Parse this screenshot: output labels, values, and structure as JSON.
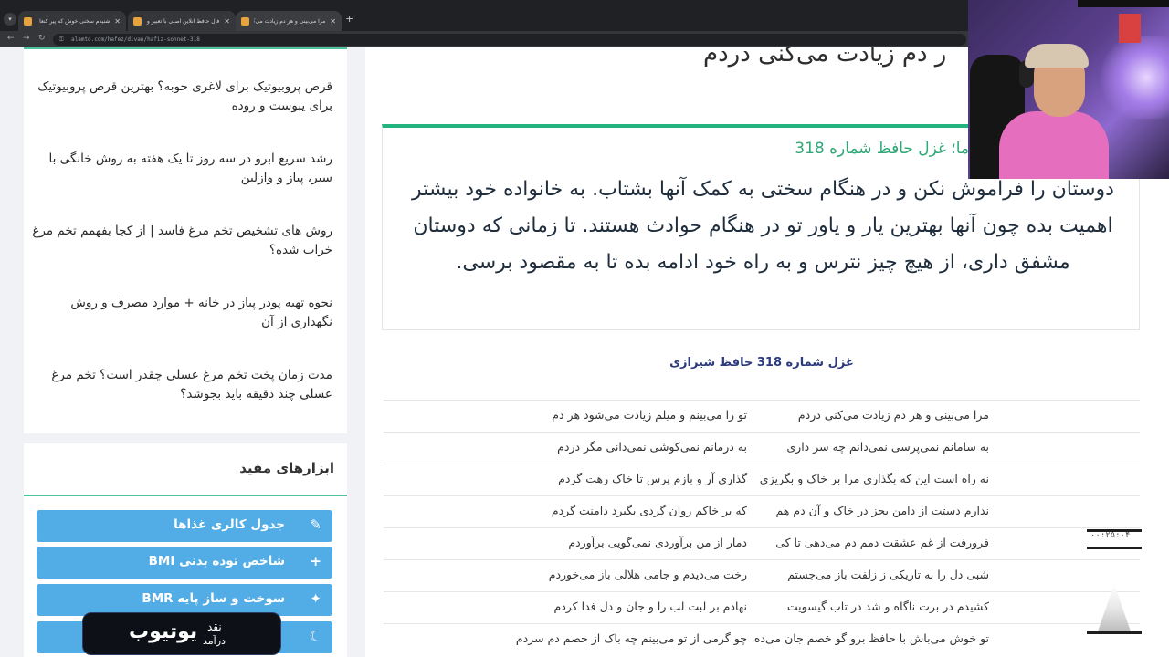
{
  "browser": {
    "menu_icon": "chevron-down-icon",
    "tabs": [
      {
        "title": "شنیدم سخنی خوش که پیر کنعا",
        "active": false
      },
      {
        "title": "فال حافظ آنلاین اصلی با تعبیر و",
        "active": false
      },
      {
        "title": "مرا می‌بینی و هر دم زیادت می‌ک",
        "active": true
      }
    ],
    "new_tab_icon": "plus-icon",
    "url": "alamto.com/hafez/divan/hafiz-sonnet-318"
  },
  "sidebar": {
    "articles": [
      "قرص پروبیوتیک برای لاغری خوبه؟ بهترین قرص پروبیوتیک برای یبوست و روده",
      "رشد سریع ابرو در سه روز تا یک هفته به روش خانگی با سیر، پیاز و وازلین",
      "روش های تشخیص تخم مرغ فاسد | از کجا بفهمم تخم مرغ خراب شده؟",
      "نحوه تهیه پودر پیاز در خانه + موارد مصرف و روش نگهداری از آن",
      "مدت زمان پخت تخم مرغ عسلی چقدر است؟ تخم مرغ عسلی چند دقیقه باید بجوشد؟"
    ],
    "tools": {
      "title": "ابزارهای مفید",
      "items": [
        {
          "label": "جدول کالری غذاها",
          "icon": "pencil-icon",
          "glyph": "✎"
        },
        {
          "label": "شاخص توده بدنی BMI",
          "icon": "plus-icon",
          "glyph": "+"
        },
        {
          "label": "سوخت و ساز پایه BMR",
          "icon": "sparkle-icon",
          "glyph": "✦"
        },
        {
          "label": "",
          "icon": "moon-icon",
          "glyph": "☾"
        }
      ]
    }
  },
  "main": {
    "heading": "ر دم زیادت می‌کنی دردم",
    "interpretation": {
      "title": "ما؛ غزل حافظ شماره 318",
      "text": "دوستان را فراموش نکن و در هنگام سختی به کمک آنها بشتاب. به خانواده خود بیشتر اهمیت بده چون آنها بهترین یار و یاور تو در هنگام حوادث هستند. تا زمانی که دوستان مشفق داری، از هیچ چیز نترس و به راه خود ادامه بده تا به مقصود برسی."
    },
    "ghazal_title": "غزل شماره 318 حافظ شیرازی",
    "verses": [
      {
        "m1": "مرا می‌بینی و هر دم زیادت می‌کنی دردم",
        "m2": "تو را می‌بینم و میلم زیادت می‌شود هر دم"
      },
      {
        "m1": "به سامانم نمی‌پرسی نمی‌دانم چه سر داری",
        "m2": "به درمانم نمی‌کوشی نمی‌دانی مگر دردم"
      },
      {
        "m1": "نه راه است این که بگذاری مرا بر خاک و بگریزی",
        "m2": "گذاری آر و بازم پرس تا خاک رهت گردم"
      },
      {
        "m1": "ندارم دستت از دامن بجز در خاک و آن دم هم",
        "m2": "که بر خاکم روان گردی بگیرد دامنت گردم"
      },
      {
        "m1": "فرورفت از غم عشقت دمم دم می‌دهی تا کی",
        "m2": "دمار از من برآوردی نمی‌گویی برآوردم"
      },
      {
        "m1": "شبی دل را به تاریکی ز زلفت باز می‌جستم",
        "m2": "رخت می‌دیدم و جامی هلالی باز می‌خوردم"
      },
      {
        "m1": "کشیدم در برت ناگاه و شد در تاب گیسویت",
        "m2": "نهادم بر لبت لب را و جان و دل فدا کردم"
      },
      {
        "m1": "تو خوش می‌باش با حافظ برو گو خصم جان می‌ده",
        "m2": "چو گرمی از تو می‌بینم چه باک از خصم دم سردم"
      }
    ]
  },
  "overlay": {
    "timer_text": "۰۰:۲۵:۰۴",
    "brand_main": "یوتیوب",
    "brand_top": "نقد",
    "brand_bottom": "درآمد"
  }
}
